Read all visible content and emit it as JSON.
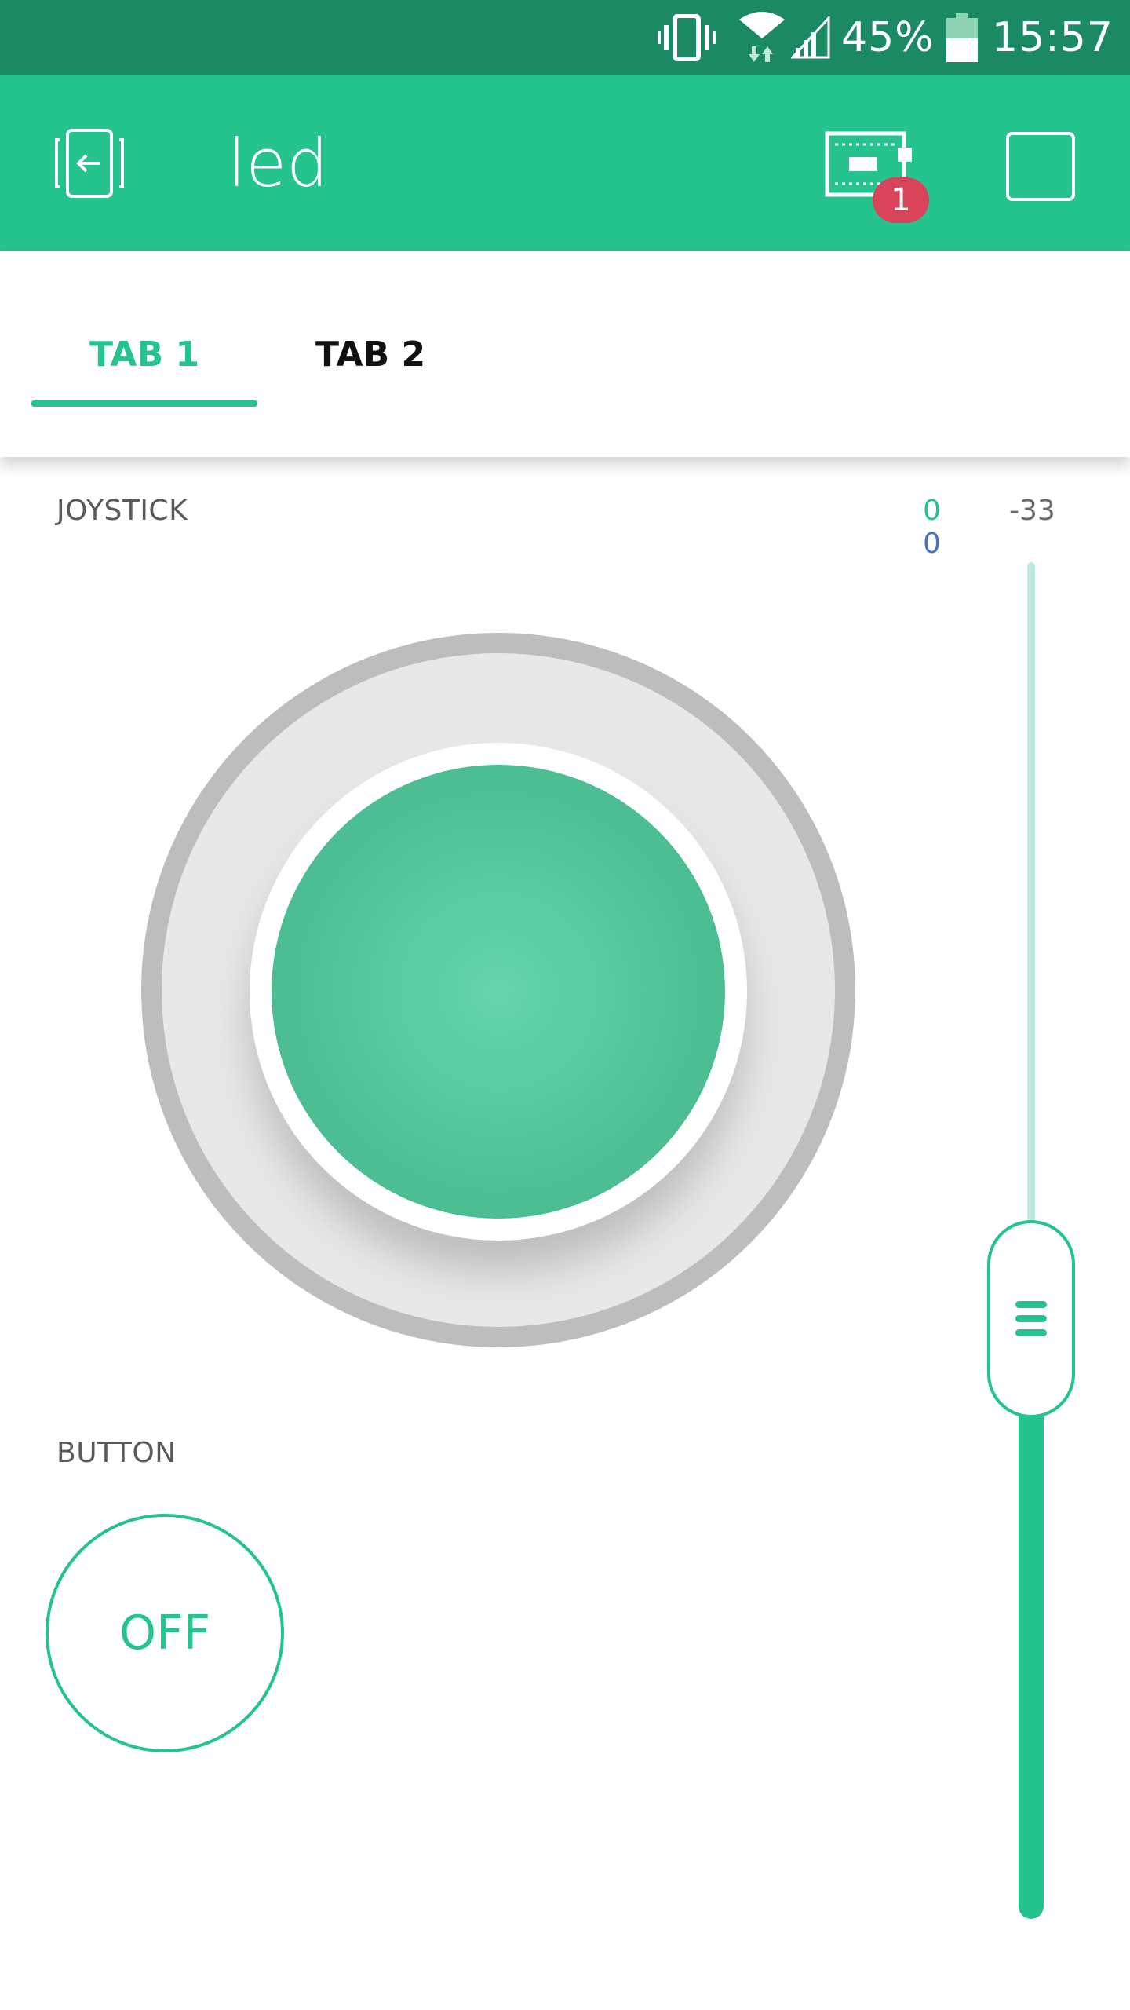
{
  "status_bar": {
    "battery_percent": "45%",
    "time": "15:57",
    "icons": [
      "vibrate-icon",
      "wifi-icon",
      "signal-icon",
      "battery-icon"
    ]
  },
  "app_bar": {
    "title": "led",
    "back_icon": "exit-project-icon",
    "device_icon": "device-icon",
    "notification_count": "1",
    "stop_icon": "stop-square-icon"
  },
  "tabs": [
    {
      "label": "TAB 1",
      "active": true
    },
    {
      "label": "TAB 2",
      "active": false
    }
  ],
  "joystick": {
    "label": "JOYSTICK",
    "x_value": "0",
    "y_value": "0"
  },
  "slider": {
    "value": "-33"
  },
  "button": {
    "label": "BUTTON",
    "state": "OFF"
  },
  "colors": {
    "status_bar": "#1b8a62",
    "accent": "#25c38d",
    "badge": "#d9435a",
    "value_x": "#25c38d",
    "value_y": "#4a72c4"
  }
}
